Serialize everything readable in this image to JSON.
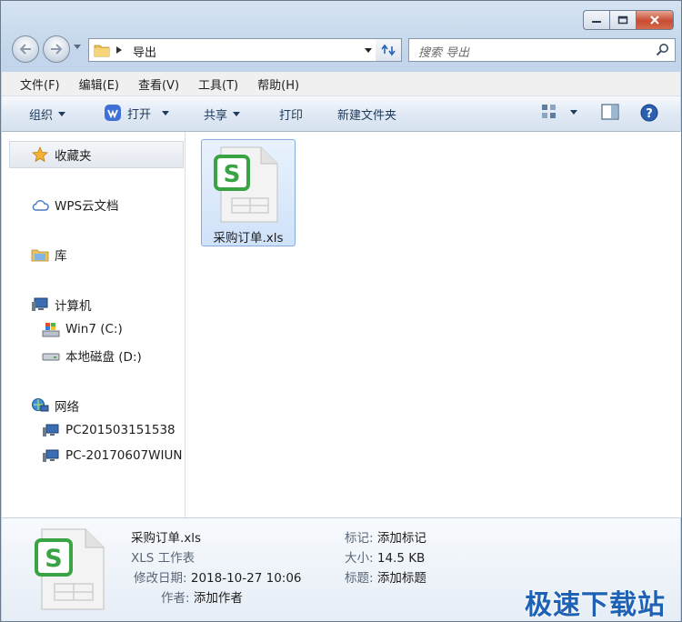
{
  "window": {
    "address": {
      "path": "导出"
    },
    "search": {
      "placeholder": "搜索 导出"
    }
  },
  "menu": [
    "文件(F)",
    "编辑(E)",
    "查看(V)",
    "工具(T)",
    "帮助(H)"
  ],
  "toolbar": {
    "organize": "组织",
    "open": "打开",
    "share": "共享",
    "print": "打印",
    "new_folder": "新建文件夹"
  },
  "nav": {
    "favorites": "收藏夹",
    "wps_cloud": "WPS云文档",
    "libraries": "库",
    "computer": "计算机",
    "drive_c": "Win7 (C:)",
    "drive_d": "本地磁盘 (D:)",
    "network": "网络",
    "pc1": "PC201503151538",
    "pc2": "PC-20170607WIUN"
  },
  "files": [
    {
      "name": "采购订单.xls",
      "icon": "wps-spreadsheet-icon"
    }
  ],
  "details": {
    "name": "采购订单.xls",
    "type": "XLS 工作表",
    "modified_label": "修改日期:",
    "modified_value": "2018-10-27 10:06",
    "author_label": "作者:",
    "author_value": "添加作者",
    "tags_label": "标记:",
    "tags_value": "添加标记",
    "size_label": "大小:",
    "size_value": "14.5 KB",
    "title_label": "标题:",
    "title_value": "添加标题"
  },
  "watermark": "极速下载站",
  "colors": {
    "accent": "#1d62b5",
    "wps_green": "#3aa343",
    "selection": "#cfe2f9"
  }
}
